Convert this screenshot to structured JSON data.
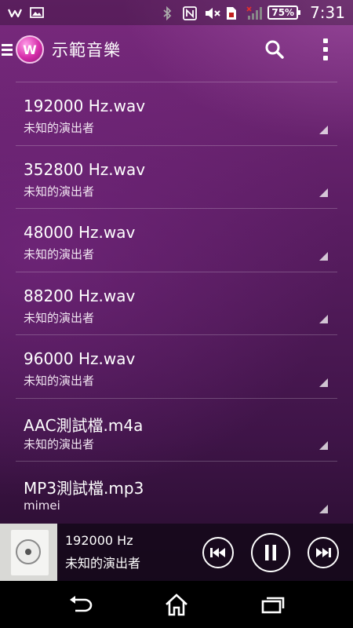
{
  "status_bar": {
    "battery_percent": "75%",
    "time": "7:31",
    "icons": [
      "walkman-notification-icon",
      "image-icon",
      "bluetooth-icon",
      "nfc-icon",
      "mute-icon",
      "sim-icon",
      "signal-icon",
      "battery-icon"
    ]
  },
  "action_bar": {
    "title": "示範音樂",
    "logo_letter": "W",
    "icons": [
      "menu-icon",
      "search-icon",
      "overflow-menu-icon"
    ]
  },
  "tracks": [
    {
      "title": "192000 Hz.wav",
      "artist": "未知的演出者"
    },
    {
      "title": "352800 Hz.wav",
      "artist": "未知的演出者"
    },
    {
      "title": "48000 Hz.wav",
      "artist": "未知的演出者"
    },
    {
      "title": "88200 Hz.wav",
      "artist": "未知的演出者"
    },
    {
      "title": "96000 Hz.wav",
      "artist": "未知的演出者"
    },
    {
      "title": "AAC測試檔.m4a",
      "artist": "未知的演出者"
    },
    {
      "title": "MP3測試檔.mp3",
      "artist": "mimei"
    }
  ],
  "now_playing": {
    "title": "192000 Hz",
    "artist": "未知的演出者",
    "controls": [
      "previous-icon",
      "pause-icon",
      "next-icon"
    ]
  },
  "nav_bar": {
    "icons": [
      "back-icon",
      "home-icon",
      "recent-apps-icon"
    ]
  },
  "colors": {
    "accent": "#d62ca9",
    "background_top": "#7a2a7e",
    "background_bottom": "#1e0a23"
  }
}
